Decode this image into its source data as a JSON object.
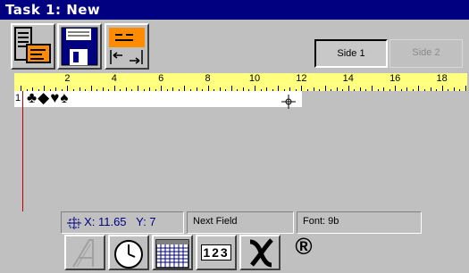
{
  "window": {
    "title": "Task 1: New"
  },
  "toolbar": {
    "properties_icon": "document-properties-icon",
    "save_icon": "floppy-disk-icon",
    "spacing_icon": "field-spacing-icon"
  },
  "sides": {
    "side1": "Side 1",
    "side2": "Side 2"
  },
  "ruler": {
    "labels": [
      "2",
      "4",
      "6",
      "8",
      "10",
      "12",
      "14",
      "16",
      "18"
    ]
  },
  "editor": {
    "line_number": "1",
    "content": "♣◆♥♠"
  },
  "status": {
    "position": "X: 11.65   Y: 7",
    "field": "Next Field",
    "font": "Font: 9b"
  },
  "bottom_tools": {
    "outline_icon": "outline-a-icon",
    "clock_icon": "clock-icon",
    "calendar_icon": "calendar-icon",
    "counter_text": "123",
    "symbol_icon": "symbol-x-icon",
    "registered": "®"
  }
}
